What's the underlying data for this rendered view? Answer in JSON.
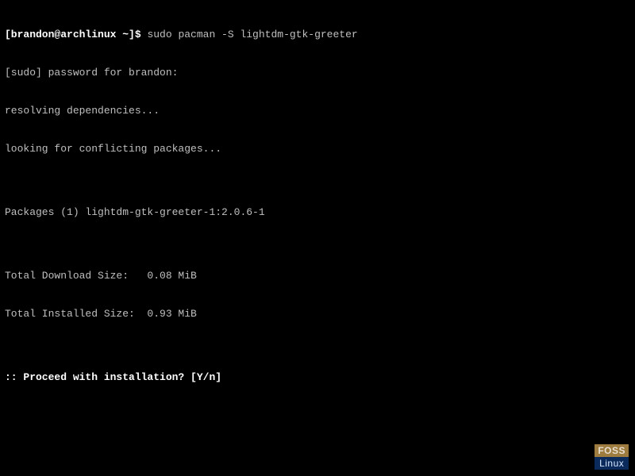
{
  "terminal": {
    "prompt": "[brandon@archlinux ~]$ ",
    "command": "sudo pacman -S lightdm-gtk-greeter",
    "lines": [
      "[sudo] password for brandon:",
      "resolving dependencies...",
      "looking for conflicting packages...",
      "",
      "Packages (1) lightdm-gtk-greeter-1:2.0.6-1",
      "",
      "Total Download Size:   0.08 MiB",
      "Total Installed Size:  0.93 MiB",
      ""
    ],
    "confirm_prefix": ":: Proceed with installation? [Y/n]"
  },
  "watermark": {
    "top": "FOSS",
    "bottom": "Linux"
  }
}
